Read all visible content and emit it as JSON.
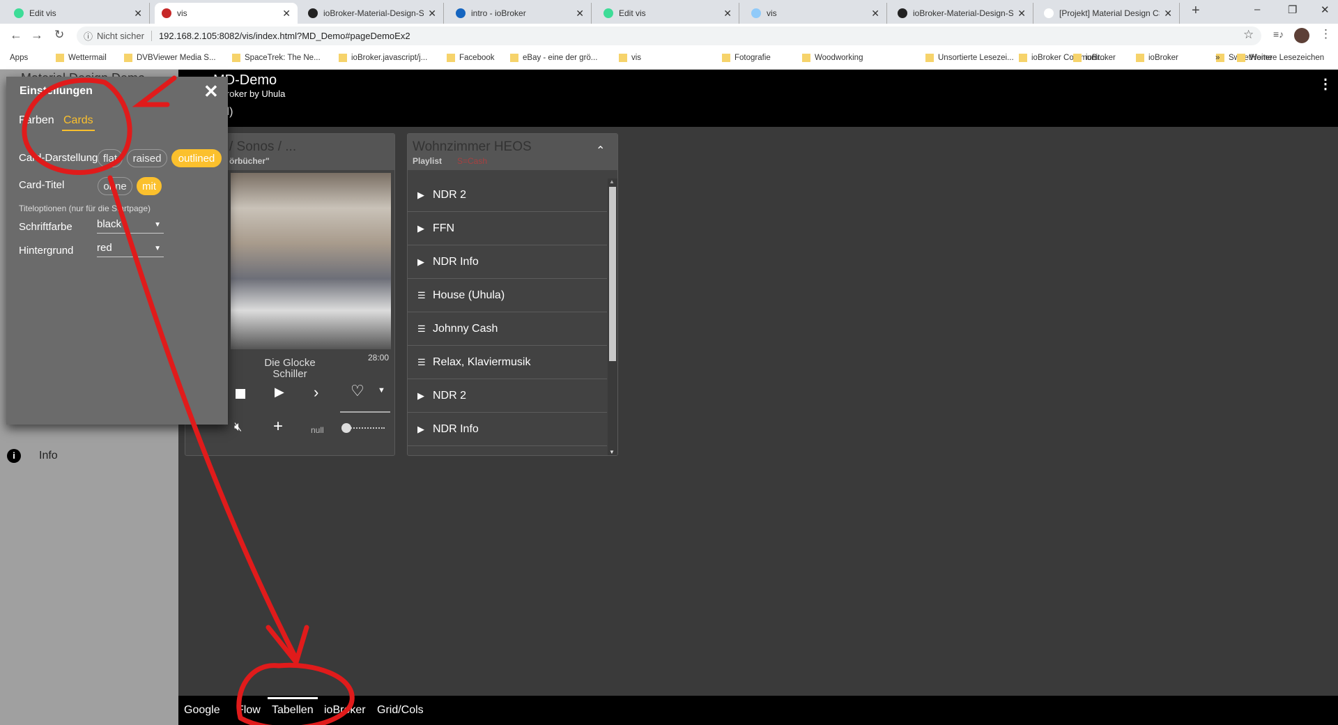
{
  "browser": {
    "tabs": [
      {
        "title": "Edit vis",
        "color": "#3ddc97"
      },
      {
        "title": "vis",
        "color": "#c62828",
        "active": true
      },
      {
        "title": "ioBroker-Material-Design-S",
        "color": "#222"
      },
      {
        "title": "intro - ioBroker",
        "color": "#1565c0"
      },
      {
        "title": "Edit vis",
        "color": "#3ddc97"
      },
      {
        "title": "vis",
        "color": "#90caf9"
      },
      {
        "title": "ioBroker-Material-Design-S",
        "color": "#222"
      },
      {
        "title": "[Projekt] Material Design CS",
        "color": "#fff"
      }
    ],
    "security": "Nicht sicher",
    "url": "192.168.2.105:8082/vis/index.html?MD_Demo#pageDemoEx2",
    "bookmarks": [
      "Apps",
      "Wettermail",
      "DVBViewer Media S...",
      "SpaceTrek: The Ne...",
      "ioBroker.javascript/j...",
      "Facebook",
      "eBay - eine der grö...",
      "vis",
      "Fotografie",
      "Woodworking",
      "Unsortierte Lesezei...",
      "ioBroker Communit...",
      "ioBroker",
      "ioBroker",
      "SweetHome",
      "»",
      "Weitere Lesezeichen"
    ]
  },
  "sidebar": {
    "title": "Material Design Demo",
    "info_label": "Info"
  },
  "header": {
    "title": "MD-Demo",
    "subtitle": "ioBroker by Uhula",
    "line3": "ll)"
  },
  "settings": {
    "title": "Einstellungen",
    "tabs": [
      "Farben",
      "Cards"
    ],
    "active_tab": "Cards",
    "card_style_label": "Card-Darstellung",
    "card_style_options": [
      "flat",
      "raised",
      "outlined"
    ],
    "card_style_selected": "outlined",
    "card_title_label": "Card-Titel",
    "card_title_options": [
      "ohne",
      "mit"
    ],
    "card_title_selected": "mit",
    "title_options_note": "Titeloptionen (nur für die Startpage)",
    "font_color_label": "Schriftfarbe",
    "font_color_value": "black",
    "background_label": "Hintergrund",
    "background_value": "red",
    "accent": "#fbc02d"
  },
  "sonos_card": {
    "title": "/ Sonos / ...",
    "subtitle": "örbücher\"",
    "time": "28:00",
    "track": "Die Glocke",
    "artist": "Schiller",
    "volume_label": "null",
    "volume": 0
  },
  "heos_card": {
    "title": "Wohnzimmer HEOS",
    "subtitle": "Playlist",
    "subtitle2": "S=Cash",
    "items": [
      {
        "label": "NDR 2",
        "icon": "play"
      },
      {
        "label": "FFN",
        "icon": "play"
      },
      {
        "label": "NDR Info",
        "icon": "play"
      },
      {
        "label": "House (Uhula)",
        "icon": "playlist"
      },
      {
        "label": "Johnny Cash",
        "icon": "playlist"
      },
      {
        "label": "Relax, Klaviermusik",
        "icon": "playlist"
      },
      {
        "label": "NDR 2",
        "icon": "play"
      },
      {
        "label": "NDR Info",
        "icon": "play"
      }
    ]
  },
  "bottom_nav": {
    "items": [
      "Google",
      "Flow",
      "Tabellen",
      "ioBroker",
      "Grid/Cols"
    ],
    "active": "Tabellen"
  }
}
